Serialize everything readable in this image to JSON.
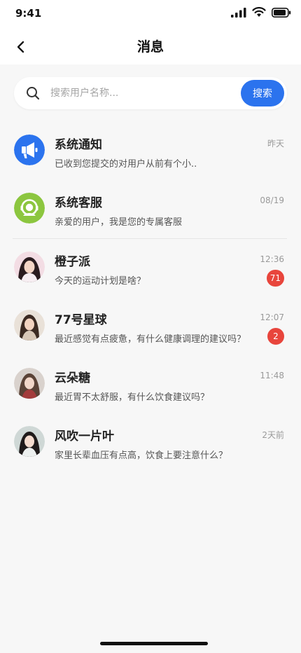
{
  "status_bar": {
    "time": "9:41"
  },
  "navbar": {
    "title": "消息"
  },
  "search": {
    "placeholder": "搜索用户名称...",
    "button_label": "搜索"
  },
  "system_items": [
    {
      "name": "系统通知",
      "preview": "已收到您提交的对用户从前有个小..",
      "time": "昨天",
      "icon": "megaphone-icon",
      "color": "#2b73ee"
    },
    {
      "name": "系统客服",
      "preview": "亲爱的用户，我是您的专属客服",
      "time": "08/19",
      "icon": "headset-icon",
      "color": "#8cc63f"
    }
  ],
  "chats": [
    {
      "name": "橙子派",
      "preview": "今天的运动计划是啥？",
      "time": "12:36",
      "badge": "71"
    },
    {
      "name": "77号星球",
      "preview": "最近感觉有点疲惫，有什么健康调理的建议吗？",
      "time": "12:07",
      "badge": "2"
    },
    {
      "name": "云朵糖",
      "preview": "最近胃不太舒服，有什么饮食建议吗？",
      "time": "11:48",
      "badge": null
    },
    {
      "name": "风吹一片叶",
      "preview": "家里长辈血压有点高，饮食上要注意什么？",
      "time": "2天前",
      "badge": null
    }
  ]
}
